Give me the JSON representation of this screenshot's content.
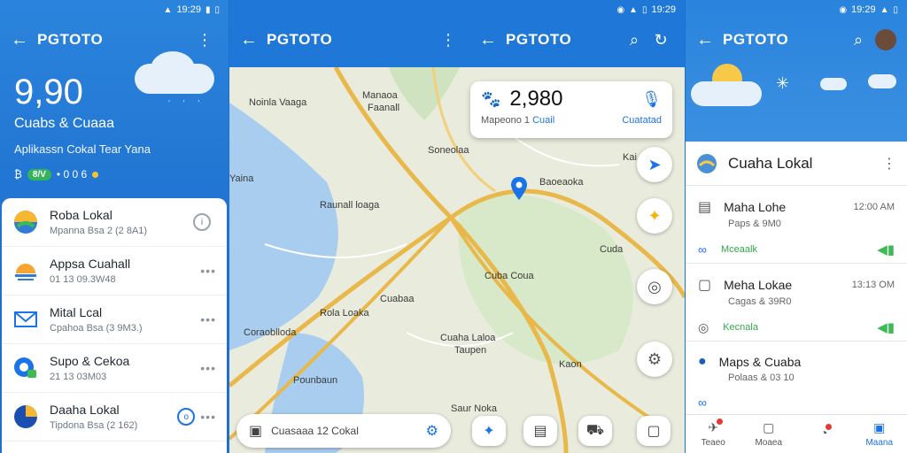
{
  "status_time": "19:29",
  "screen1": {
    "title": "PGTOTO",
    "hero": {
      "value": "9,90",
      "subtitle": "Cuabs & Cuaaa",
      "description": "Aplikassn Cokal Tear Yana",
      "pill": "8/V",
      "meta": "• 0 0 6"
    },
    "items": [
      {
        "title": "Roba Lokal",
        "sub": "Mpanna Bsa 2 (2 8A1)"
      },
      {
        "title": "Appsa Cuahall",
        "sub": "01 13 09.3W48"
      },
      {
        "title": "Mital Lcal",
        "sub": "Cpahoa Bsa (3 9M3.)"
      },
      {
        "title": "Supo & Cekoa",
        "sub": "21 13 03M03"
      },
      {
        "title": "Daaha Lokal",
        "sub": "Tipdona Bsa (2 162)"
      }
    ]
  },
  "screen2": {
    "title": "PGTOTO",
    "search_card": {
      "value": "2,980",
      "left": "Mapeono 1",
      "mid": "Cuail",
      "right": "Cuatatad"
    },
    "labels": [
      "Noinla Vaaga",
      "Manaoa",
      "Faanall",
      "Soneolaa",
      "Yaina",
      "Raunall loaga",
      "Baoeaoka",
      "Kai",
      "Cuda",
      "Cuba Coua",
      "Cuabaa",
      "Rola Loaka",
      "Coraoblloda",
      "Cuaha Laloa",
      "Taupen",
      "Kaon",
      "Pounbaun",
      "Saur Noka"
    ],
    "bottom_search": "Cuasaaa 12 Cokal"
  },
  "screen3": {
    "title": "PGTOTO",
    "card_title": "Cuaha Lokal",
    "items": [
      {
        "title": "Maha Lohe",
        "sub": "Paps & 9M0",
        "time": "12:00 AM",
        "tag": "Mceaalk"
      },
      {
        "title": "Meha Lokae",
        "sub": "Cagas & 39R0",
        "time": "13:13 OM",
        "tag": "Kecnala"
      },
      {
        "title": "Maps & Cuaba",
        "sub": "Polaas & 03 10",
        "time": "",
        "tag": ""
      }
    ],
    "tabs": [
      "Teaeo",
      "Moaea",
      "",
      "Maana"
    ]
  }
}
